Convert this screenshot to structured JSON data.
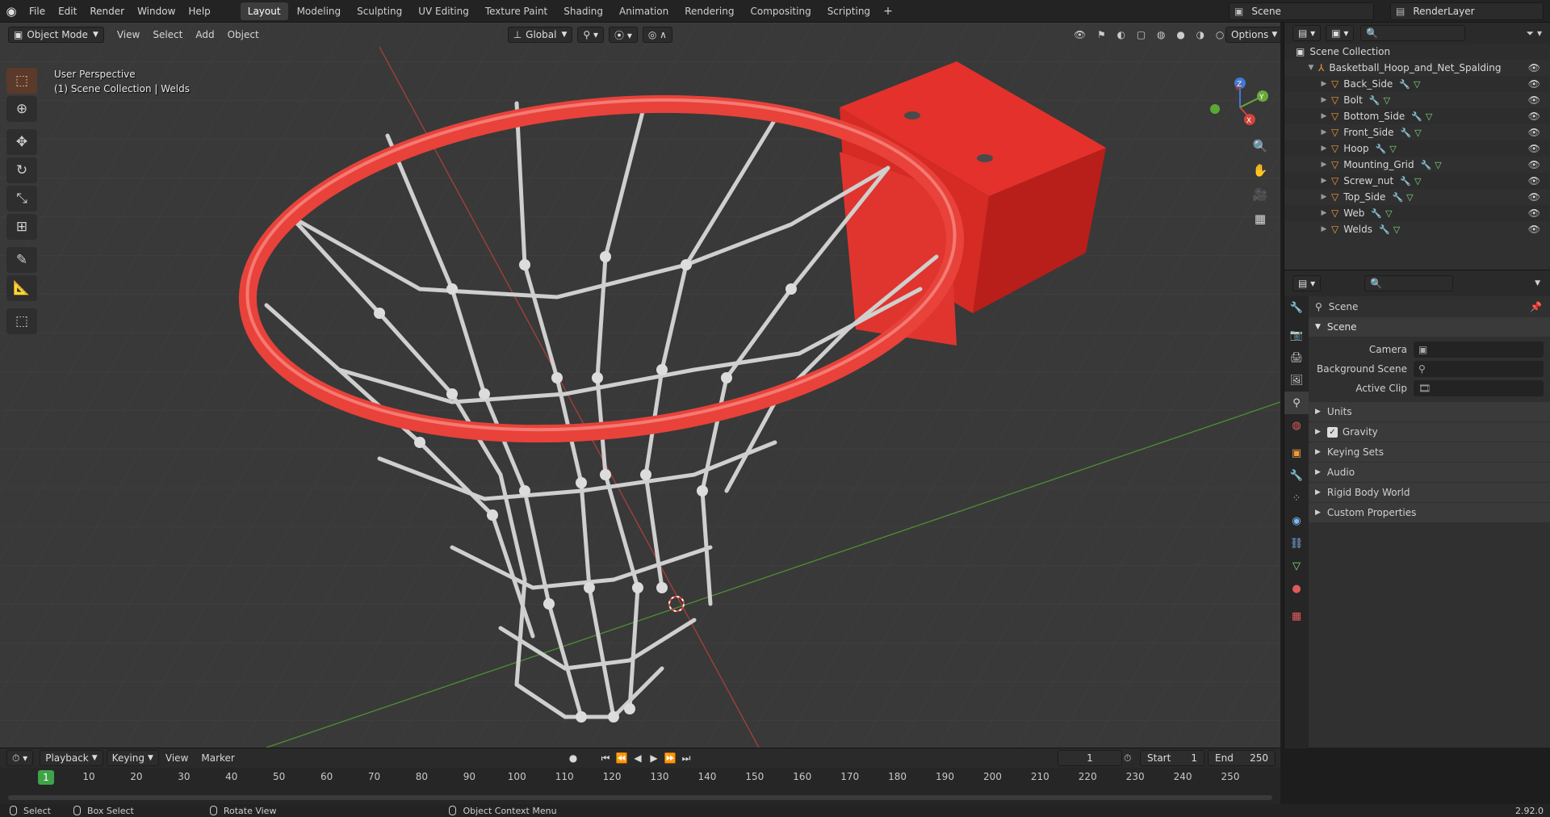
{
  "menu": [
    "File",
    "Edit",
    "Render",
    "Window",
    "Help"
  ],
  "workspace_tabs": [
    {
      "label": "Layout",
      "active": true
    },
    {
      "label": "Modeling"
    },
    {
      "label": "Sculpting"
    },
    {
      "label": "UV Editing"
    },
    {
      "label": "Texture Paint"
    },
    {
      "label": "Shading"
    },
    {
      "label": "Animation"
    },
    {
      "label": "Rendering"
    },
    {
      "label": "Compositing"
    },
    {
      "label": "Scripting"
    }
  ],
  "add_tab_icon": "+",
  "scene_name": "Scene",
  "view_layer": "RenderLayer",
  "viewport": {
    "mode": "Object Mode",
    "menus": [
      "View",
      "Select",
      "Add",
      "Object"
    ],
    "orientation": "Global",
    "options_label": "Options",
    "perspective_label": "User Perspective",
    "collection_label": "(1) Scene Collection | Welds",
    "gizmo": {
      "x": "X",
      "y": "Y",
      "z": "Z"
    }
  },
  "outliner": {
    "root": "Scene Collection",
    "parent": "Basketball_Hoop_and_Net_Spalding",
    "children": [
      "Back_Side",
      "Bolt",
      "Bottom_Side",
      "Front_Side",
      "Hoop",
      "Mounting_Grid",
      "Screw_nut",
      "Top_Side",
      "Web",
      "Welds"
    ]
  },
  "properties": {
    "header": "Scene",
    "panel": "Scene",
    "rows": [
      {
        "label": "Camera"
      },
      {
        "label": "Background Scene"
      },
      {
        "label": "Active Clip"
      }
    ],
    "subpanels": [
      "Units",
      "Gravity",
      "Keying Sets",
      "Audio",
      "Rigid Body World",
      "Custom Properties"
    ]
  },
  "timeline": {
    "menus": [
      "Playback",
      "Keying",
      "View",
      "Marker"
    ],
    "current_frame": "1",
    "start_label": "Start",
    "start": "1",
    "end_label": "End",
    "end": "250",
    "ticks": [
      "1",
      "10",
      "20",
      "30",
      "40",
      "50",
      "60",
      "70",
      "80",
      "90",
      "100",
      "110",
      "120",
      "130",
      "140",
      "150",
      "160",
      "170",
      "180",
      "190",
      "200",
      "210",
      "220",
      "230",
      "240",
      "250"
    ]
  },
  "statusbar": {
    "items": [
      "Select",
      "Box Select",
      "Rotate View",
      "Object Context Menu"
    ],
    "version": "2.92.0"
  },
  "colors": {
    "accent": "#e8423a",
    "net": "#c9c9c9",
    "x_axis": "#c0392b",
    "y_axis": "#5fa83a"
  }
}
